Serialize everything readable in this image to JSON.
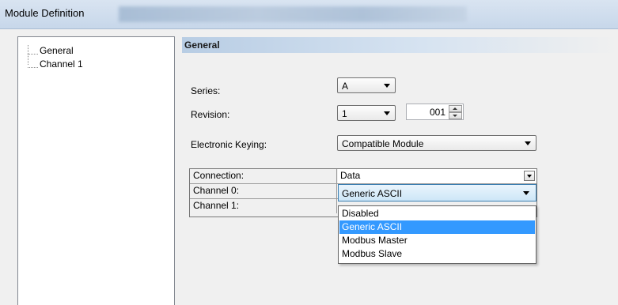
{
  "window": {
    "title": "Module Definition"
  },
  "tree": {
    "items": [
      {
        "label": "General"
      },
      {
        "label": "Channel 1"
      }
    ]
  },
  "section": {
    "title": "General"
  },
  "series": {
    "label": "Series:",
    "value": "A"
  },
  "revision": {
    "label": "Revision:",
    "major": "1",
    "minor": "001"
  },
  "keying": {
    "label": "Electronic Keying:",
    "value": "Compatible Module"
  },
  "grid": {
    "rows": [
      {
        "label": "Connection:",
        "value": "Data"
      },
      {
        "label": "Channel 0:",
        "value": "Generic ASCII"
      },
      {
        "label": "Channel 1:",
        "value": ""
      }
    ]
  },
  "dropdown": {
    "options": [
      "Disabled",
      "Generic ASCII",
      "Modbus Master",
      "Modbus Slave"
    ],
    "selected": "Generic ASCII"
  },
  "colors": {
    "selection": "#3399ff",
    "header_gradient": "#b8cde4"
  }
}
